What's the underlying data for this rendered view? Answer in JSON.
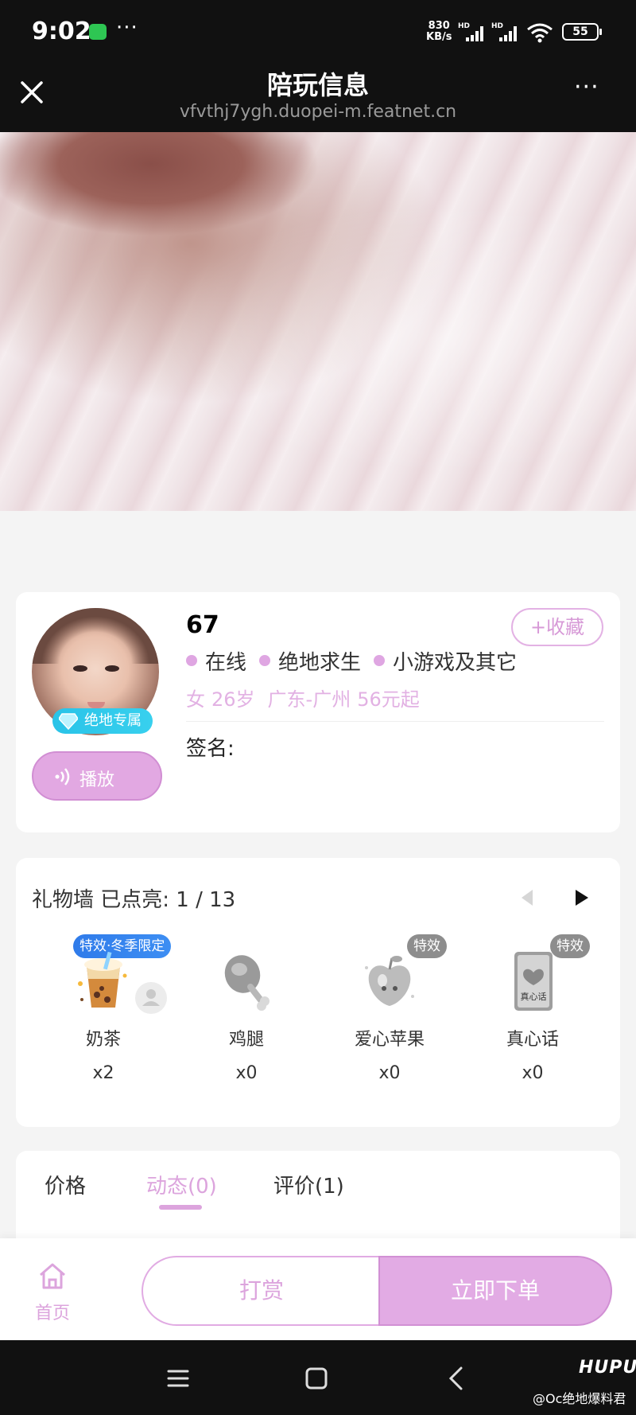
{
  "status_bar": {
    "time": "9:02",
    "more": "···",
    "net_speed_value": "830",
    "net_speed_unit": "KB/s",
    "hd_1": "HD",
    "hd_2": "HD",
    "battery": "55"
  },
  "nav": {
    "title": "陪玩信息",
    "url": "vfvthj7ygh.duopei-m.featnet.cn",
    "more": "···",
    "close_icon": "close-icon"
  },
  "profile": {
    "name": "67",
    "collect_label": "+收藏",
    "avatar_badge": "绝地专属",
    "play_label": "播放",
    "tags": [
      "在线",
      "绝地求生",
      "小游戏及其它"
    ],
    "gender": "女",
    "age": "26岁",
    "location": "广东-广州",
    "price": "56元起",
    "signature_label": "签名:",
    "accent_color": "#dca4dd"
  },
  "gift_wall": {
    "title": "礼物墙 已点亮: 1 / 13",
    "items": [
      {
        "name": "奶茶",
        "count": "x2",
        "badge": "特效·冬季限定",
        "icon": "milk-tea-icon"
      },
      {
        "name": "鸡腿",
        "count": "x0",
        "badge": "",
        "icon": "drumstick-icon"
      },
      {
        "name": "爱心苹果",
        "count": "x0",
        "badge": "特效",
        "icon": "heart-apple-icon"
      },
      {
        "name": "真心话",
        "count": "x0",
        "badge": "特效",
        "icon": "truth-card-icon",
        "card_text": "真心话"
      }
    ]
  },
  "tabs": [
    {
      "label": "价格",
      "active": false
    },
    {
      "label": "动态(0)",
      "active": true
    },
    {
      "label": "评价(1)",
      "active": false
    }
  ],
  "bottom_bar": {
    "home_label": "首页",
    "reward_label": "打赏",
    "order_label": "立即下单"
  },
  "watermark": {
    "logo": "HUPU",
    "user": "@Oc绝地爆料君"
  }
}
